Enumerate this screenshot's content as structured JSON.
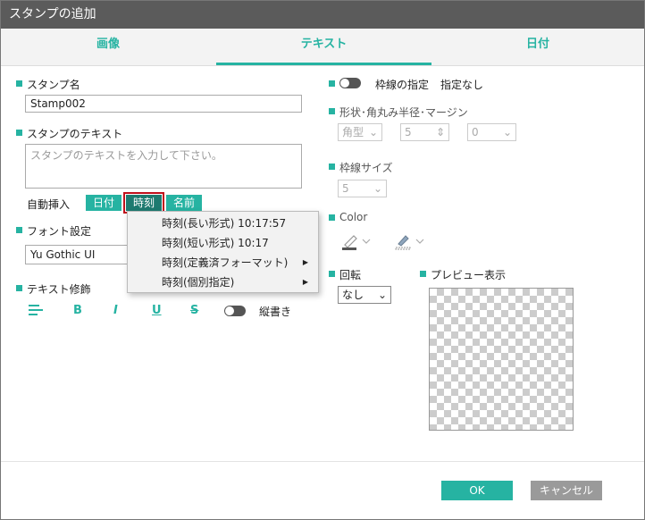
{
  "window": {
    "title": "スタンプの追加"
  },
  "tabs": [
    {
      "label": "画像"
    },
    {
      "label": "テキスト"
    },
    {
      "label": "日付"
    }
  ],
  "left": {
    "stamp_name_label": "スタンプ名",
    "stamp_name_value": "Stamp002",
    "stamp_text_label": "スタンプのテキスト",
    "stamp_text_placeholder": "スタンプのテキストを入力して下さい。",
    "auto_insert_label": "自動挿入",
    "auto_insert_buttons": [
      "日付",
      "時刻",
      "名前"
    ],
    "font_label": "フォント設定",
    "font_value": "Yu Gothic UI",
    "text_decoration_label": "テキスト修飾",
    "format_buttons": [
      "B",
      "I",
      "U",
      "S"
    ],
    "vertical_label": "縦書き"
  },
  "time_menu": {
    "items": [
      {
        "label": "時刻(長い形式) 10:17:57",
        "submenu": false
      },
      {
        "label": "時刻(短い形式) 10:17",
        "submenu": false
      },
      {
        "label": "時刻(定義済フォーマット)",
        "submenu": true
      },
      {
        "label": "時刻(個別指定)",
        "submenu": true
      }
    ]
  },
  "right": {
    "border_label": "枠線の指定",
    "border_value": "指定なし",
    "shape_label": "形状･角丸み半径･マージン",
    "shape_value": "角型",
    "radius_value": "5",
    "margin_value": "0",
    "border_size_label": "枠線サイズ",
    "border_size_value": "5",
    "color_label": "Color",
    "rotation_label": "回転",
    "rotation_value": "なし",
    "preview_label": "プレビュー表示"
  },
  "footer": {
    "ok_label": "OK",
    "cancel_label": "キャンセル"
  },
  "colors": {
    "accent": "#26b3a2",
    "titlebar": "#5b5b5b",
    "highlight": "#c0101c"
  }
}
